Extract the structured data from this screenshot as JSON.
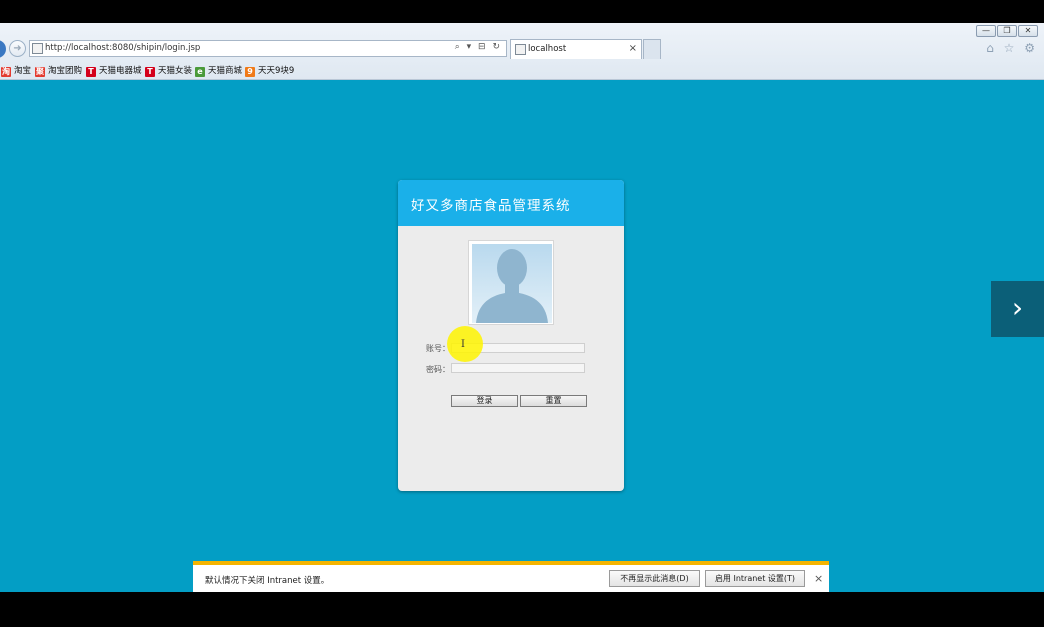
{
  "browser": {
    "url": "http://localhost:8080/shipin/login.jsp",
    "tab_title": "localhost",
    "tab_close": "×",
    "address_tools": "⌕ ▾ ⊟ ↻",
    "window_controls": {
      "minimize": "—",
      "restore": "❐",
      "close": "✕"
    },
    "right_icons": "⌂ ☆ ⚙",
    "favorites": [
      {
        "label": "淘宝",
        "icon": "淘",
        "color": "#e33a2f"
      },
      {
        "label": "淘宝团购",
        "icon": "聚",
        "color": "#e33a2f"
      },
      {
        "label": "天猫电器城",
        "icon": "T",
        "color": "#d4001b"
      },
      {
        "label": "天猫女装",
        "icon": "T",
        "color": "#d4001b"
      },
      {
        "label": "天猫商城",
        "icon": "e",
        "color": "#4a9a3a"
      },
      {
        "label": "天天9块9",
        "icon": "9",
        "color": "#f07a18"
      }
    ]
  },
  "login": {
    "title": "好又多商店食品管理系统",
    "account_label": "账号：",
    "account_value": "",
    "password_label": "密码：",
    "password_value": "",
    "login_button": "登录",
    "reset_button": "重置"
  },
  "cursor_glyph": "I",
  "side_arrow": "›",
  "notification": {
    "message": "默认情况下关闭 Intranet 设置。",
    "dont_show_button": "不再显示此消息(D)",
    "enable_button": "启用 Intranet 设置(T)",
    "close": "×"
  },
  "colors": {
    "page_background": "#039ec5",
    "login_header": "#1ab0e9",
    "notification_border": "#f4b400"
  }
}
